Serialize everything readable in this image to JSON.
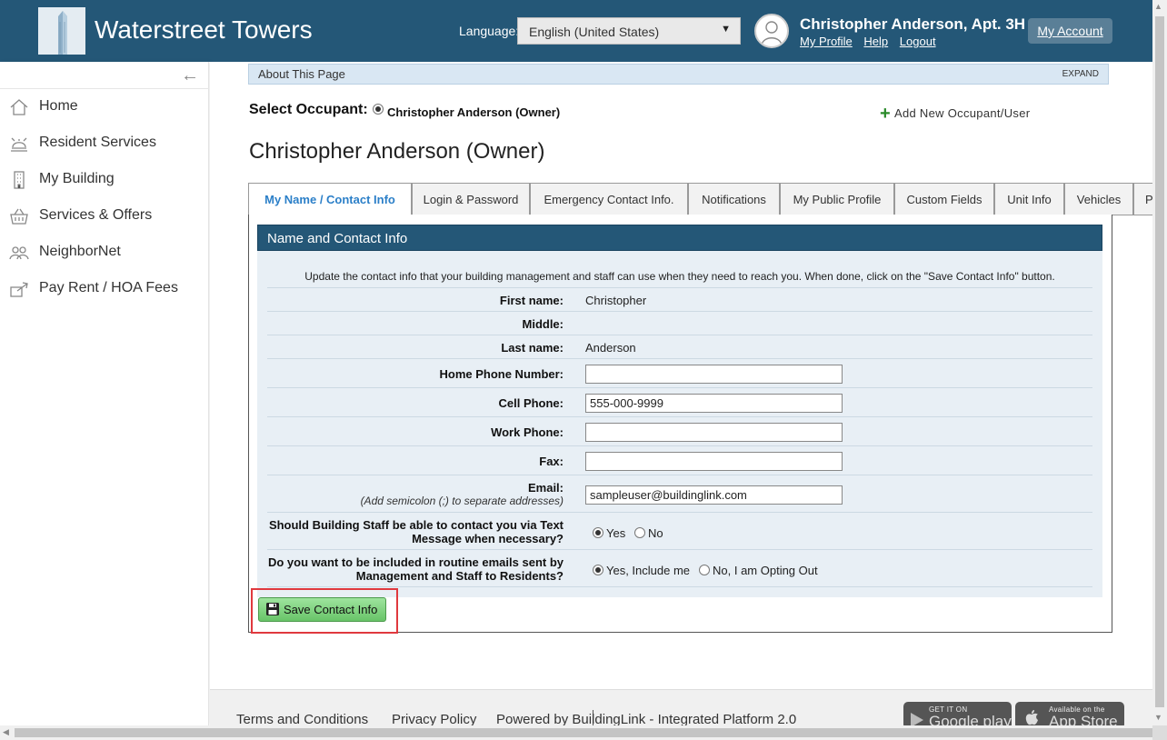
{
  "header": {
    "brand": "Waterstreet Towers",
    "language_label": "Language:",
    "language_value": "English (United States)",
    "user_name": "Christopher Anderson, Apt. 3H",
    "links": [
      "My Profile",
      "Help",
      "Logout"
    ],
    "my_account": "My Account"
  },
  "sidebar": {
    "items": [
      {
        "label": "Home",
        "icon": "home-icon"
      },
      {
        "label": "Resident Services",
        "icon": "service-bell-icon"
      },
      {
        "label": "My Building",
        "icon": "building-icon"
      },
      {
        "label": "Services & Offers",
        "icon": "basket-icon"
      },
      {
        "label": "NeighborNet",
        "icon": "people-icon"
      },
      {
        "label": "Pay Rent / HOA Fees",
        "icon": "payment-icon"
      }
    ]
  },
  "about": {
    "title": "About This Page",
    "expand": "EXPAND"
  },
  "occupant": {
    "label": "Select Occupant:",
    "name": "Christopher Anderson (Owner)",
    "add_new": "Add New Occupant/User"
  },
  "page_title": "Christopher Anderson (Owner)",
  "tabs": [
    "My Name / Contact Info",
    "Login & Password",
    "Emergency Contact Info.",
    "Notifications",
    "My Public Profile",
    "Custom Fields",
    "Unit Info",
    "Vehicles",
    "P"
  ],
  "panel": {
    "title": "Name and Contact Info",
    "intro": "Update the contact info that your building management and staff can use when they need to reach you. When done, click on the \"Save Contact Info\" button."
  },
  "form": {
    "first_name_label": "First name:",
    "first_name": "Christopher",
    "middle_label": "Middle:",
    "middle": "",
    "last_name_label": "Last name:",
    "last_name": "Anderson",
    "home_phone_label": "Home Phone Number:",
    "home_phone": "",
    "cell_phone_label": "Cell Phone:",
    "cell_phone": "555-000-9999",
    "work_phone_label": "Work Phone:",
    "work_phone": "",
    "fax_label": "Fax:",
    "fax": "",
    "email_label": "Email:",
    "email_hint": "(Add semicolon (;) to separate addresses)",
    "email": "sampleuser@buildinglink.com",
    "sms_q1": "Should Building Staff be able to contact you via Text",
    "sms_q2": "Message when necessary?",
    "sms_yes": "Yes",
    "sms_no": "No",
    "sms_selected": "Yes",
    "emails_q1": "Do you want to be included in routine emails sent by",
    "emails_q2": "Management and Staff to Residents?",
    "emails_yes": "Yes, Include me",
    "emails_no": "No, I am Opting Out",
    "emails_selected": "Yes, Include me"
  },
  "save_button": "Save Contact Info",
  "footer": {
    "terms": "Terms and Conditions",
    "privacy": "Privacy Policy",
    "powered": "Powered by BuildingLink - Integrated Platform 2.0",
    "google_small": "GET IT ON",
    "google_big": "Google play",
    "apple_small": "Available on the",
    "apple_big": "App Store"
  }
}
